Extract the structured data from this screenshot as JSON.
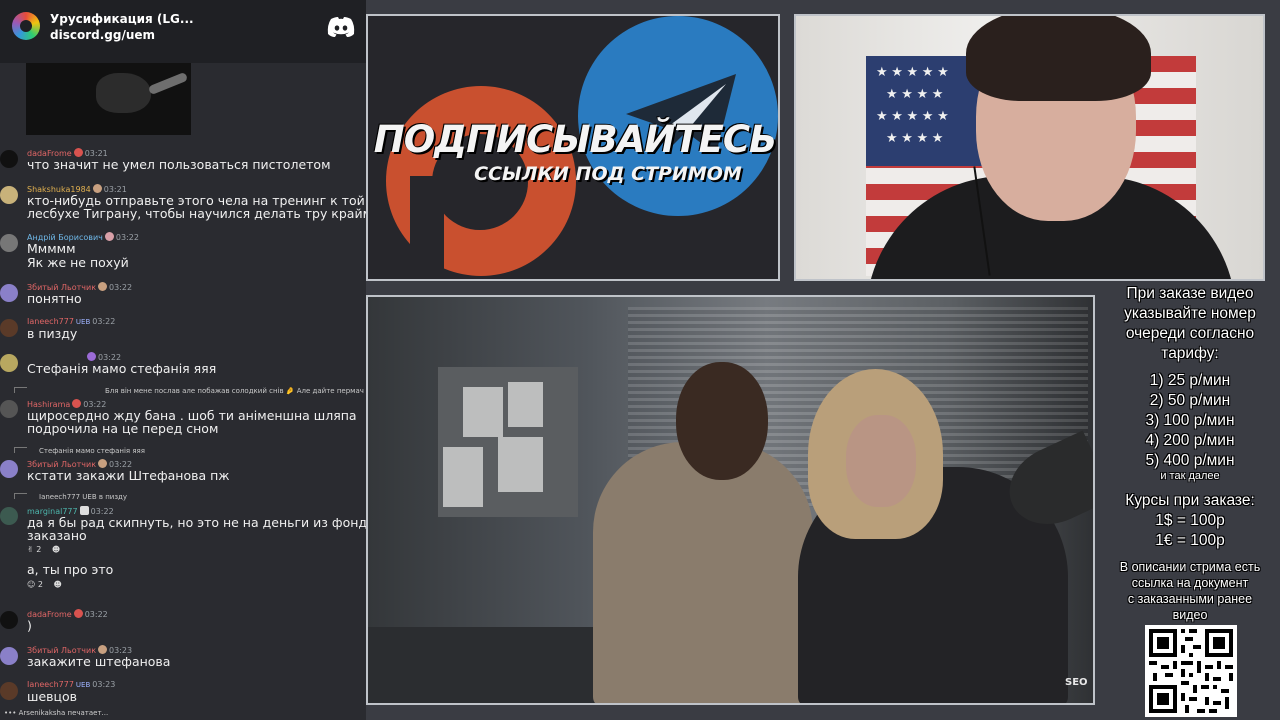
{
  "server": {
    "name": "Урусификация (LG...",
    "link": "discord.gg/uem"
  },
  "chat": {
    "messages": [
      {
        "user": "dadaFrome",
        "time": "03:21",
        "text": "что значит не умел пользоваться пистолетом",
        "user_color": "#e06666",
        "avatar_color": "#111111"
      },
      {
        "user": "Shakshuka1984",
        "time": "03:21",
        "text": [
          "кто-нибудь отправьте этого чела на тренинг к той",
          "лесбухе Тиграну, чтобы научился делать тру краймы"
        ],
        "user_color": "#e0b050",
        "avatar_color": "#c8b27a"
      },
      {
        "user": "Андрій Борисович",
        "time": "03:22",
        "text": [
          "Ммммм",
          "Як же не похуй"
        ],
        "user_color": "#6fb8e8",
        "avatar_color": "#777777"
      },
      {
        "user": "Збитый Льотчик",
        "time": "03:22",
        "text": "понятно",
        "user_color": "#e06666",
        "avatar_color": "#8a80c8"
      },
      {
        "user": "Ianeech777",
        "time": "03:22",
        "text": "в пизду",
        "tag": "UEB",
        "user_color": "#e06666",
        "avatar_color": "#5a3a28"
      },
      {
        "user": "",
        "time": "03:22",
        "text": "Стефанія мамо стефанія яяя",
        "avatar_color": "#b8a860"
      },
      {
        "reply": "Бля він мене послав але побажав солодкий снів 🤌 Але дайте пермач пж",
        "user": "Hashirama",
        "time": "03:22",
        "text": [
          "щиросердно жду бана  . шоб ти  аніменшна шляпа",
          "подрочила на це перед сном"
        ],
        "user_color": "#e06666",
        "avatar_color": "#555555"
      },
      {
        "reply": "Стефанія мамо стефанія яяя",
        "user": "Збитый Льотчик",
        "time": "03:22",
        "text": "кстати закажи Штефанова пж",
        "user_color": "#e06666",
        "avatar_color": "#8a80c8"
      },
      {
        "reply": "Ianeech777 UEB  в пизду",
        "user": "marginal777",
        "time": "03:22",
        "text": [
          "да я бы рад скипнуть, но это не на деньги из фонда",
          "заказано"
        ],
        "reaction": "2",
        "user_color": "#4db6ac",
        "avatar_color": "#3c5a50"
      },
      {
        "text": "а, ты про это",
        "reaction": "2"
      },
      {
        "user": "dadaFrome",
        "time": "03:22",
        "text": ")",
        "user_color": "#e06666",
        "avatar_color": "#111111"
      },
      {
        "user": "Збитый Льотчик",
        "time": "03:23",
        "text": "закажите штефанова",
        "user_color": "#e06666",
        "avatar_color": "#8a80c8"
      },
      {
        "user": "Ianeech777",
        "time": "03:23",
        "text": "шевцов",
        "tag": "UEB",
        "user_color": "#e06666",
        "avatar_color": "#5a3a28"
      }
    ],
    "typing": "Arsenikaksha печатает..."
  },
  "promo": {
    "title": "ПОДПИСЫВАЙТЕСЬ",
    "subtitle": "ССЫЛКИ ПОД СТРИМОМ",
    "patreon_color": "#c9502f",
    "telegram_color": "#2a7bc0"
  },
  "video": {
    "watermark": "SEO"
  },
  "info": {
    "order_note": [
      "При заказе видео",
      "указывайте номер",
      "очереди согласно",
      "тарифу:"
    ],
    "tariffs": [
      "1) 25 р/мин",
      "2) 50 р/мин",
      "3) 100 р/мин",
      "4) 200 р/мин",
      "5) 400 р/мин"
    ],
    "tariffs_more": "и так далее",
    "rates_title": "Курсы при заказе:",
    "rates": [
      "1$ = 100р",
      "1€ = 100р"
    ],
    "description_note": [
      "В описании стрима есть",
      "ссылка на документ",
      "с заказанными ранее",
      "видео"
    ]
  },
  "colors": {
    "background": "#3a3c43",
    "chat_bg": "#2a2b30",
    "frame_border": "#bfc3c9"
  }
}
